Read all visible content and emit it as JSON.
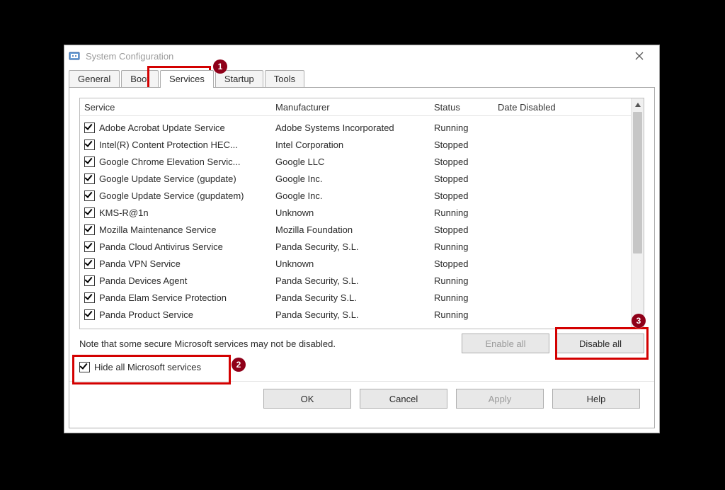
{
  "title": "System Configuration",
  "tabs": {
    "general": "General",
    "boot": "Boot",
    "services": "Services",
    "startup": "Startup",
    "tools": "Tools"
  },
  "columns": {
    "service": "Service",
    "manufacturer": "Manufacturer",
    "status": "Status",
    "date": "Date Disabled"
  },
  "rows": [
    {
      "checked": true,
      "service": "Adobe Acrobat Update Service",
      "manufacturer": "Adobe Systems Incorporated",
      "status": "Running"
    },
    {
      "checked": true,
      "service": "Intel(R) Content Protection HEC...",
      "manufacturer": "Intel Corporation",
      "status": "Stopped"
    },
    {
      "checked": true,
      "service": "Google Chrome Elevation Servic...",
      "manufacturer": "Google LLC",
      "status": "Stopped"
    },
    {
      "checked": true,
      "service": "Google Update Service (gupdate)",
      "manufacturer": "Google Inc.",
      "status": "Stopped"
    },
    {
      "checked": true,
      "service": "Google Update Service (gupdatem)",
      "manufacturer": "Google Inc.",
      "status": "Stopped"
    },
    {
      "checked": true,
      "service": "KMS-R@1n",
      "manufacturer": "Unknown",
      "status": "Running"
    },
    {
      "checked": true,
      "service": "Mozilla Maintenance Service",
      "manufacturer": "Mozilla Foundation",
      "status": "Stopped"
    },
    {
      "checked": true,
      "service": "Panda Cloud Antivirus Service",
      "manufacturer": "Panda Security, S.L.",
      "status": "Running"
    },
    {
      "checked": true,
      "service": "Panda VPN Service",
      "manufacturer": "Unknown",
      "status": "Stopped"
    },
    {
      "checked": true,
      "service": "Panda Devices Agent",
      "manufacturer": "Panda Security, S.L.",
      "status": "Running"
    },
    {
      "checked": true,
      "service": "Panda Elam Service Protection",
      "manufacturer": "Panda Security S.L.",
      "status": "Running"
    },
    {
      "checked": true,
      "service": "Panda Product Service",
      "manufacturer": "Panda Security, S.L.",
      "status": "Running"
    }
  ],
  "note": "Note that some secure Microsoft services may not be disabled.",
  "buttons": {
    "enable_all": "Enable all",
    "disable_all": "Disable all",
    "ok": "OK",
    "cancel": "Cancel",
    "apply": "Apply",
    "help": "Help"
  },
  "hide_ms": {
    "checked": true,
    "label": "Hide all Microsoft services"
  },
  "callouts": {
    "one": "1",
    "two": "2",
    "three": "3"
  }
}
